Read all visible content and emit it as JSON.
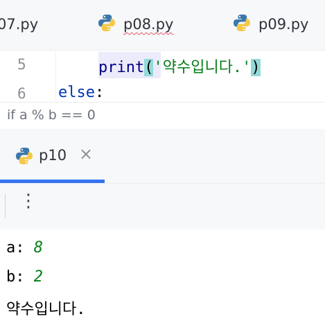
{
  "editor_tabs": [
    {
      "label": "07.py"
    },
    {
      "label": "p08.py"
    },
    {
      "label": "p09.py"
    }
  ],
  "code": {
    "lines": [
      {
        "number": "5",
        "keyword": "",
        "fn": "print",
        "open": "(",
        "string": "'약수입니다.'",
        "close": ")"
      },
      {
        "number": "6",
        "keyword": "else",
        "colon": ":"
      }
    ]
  },
  "breadcrumb": {
    "text": "if a % b == 0"
  },
  "run_panel": {
    "tab_label": "p10",
    "close_symbol": "×",
    "more_symbol": "⋮"
  },
  "console": {
    "lines": [
      {
        "label": "a: ",
        "value": "8"
      },
      {
        "label": "b: ",
        "value": "2"
      },
      {
        "label": "약수입니다.",
        "value": ""
      }
    ]
  },
  "colors": {
    "accent": "#3574f0",
    "string": "#067d17",
    "keyword": "#0033b3"
  }
}
